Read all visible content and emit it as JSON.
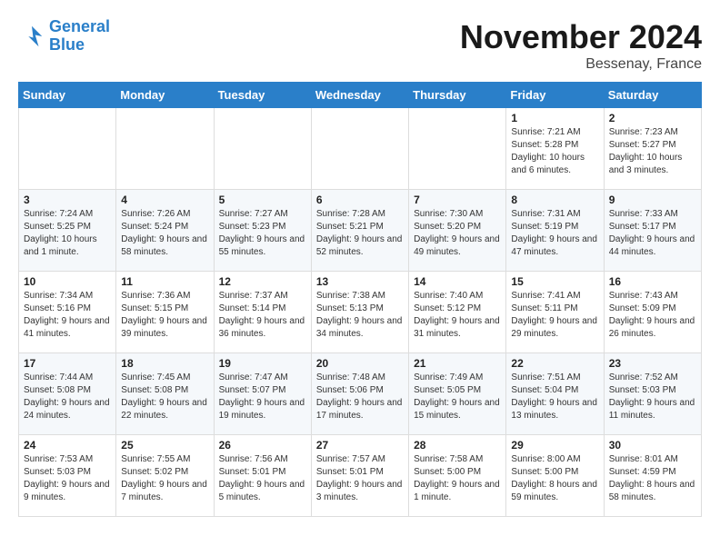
{
  "header": {
    "logo_line1": "General",
    "logo_line2": "Blue",
    "title": "November 2024",
    "subtitle": "Bessenay, France"
  },
  "days_of_week": [
    "Sunday",
    "Monday",
    "Tuesday",
    "Wednesday",
    "Thursday",
    "Friday",
    "Saturday"
  ],
  "weeks": [
    [
      {
        "day": "",
        "info": ""
      },
      {
        "day": "",
        "info": ""
      },
      {
        "day": "",
        "info": ""
      },
      {
        "day": "",
        "info": ""
      },
      {
        "day": "",
        "info": ""
      },
      {
        "day": "1",
        "info": "Sunrise: 7:21 AM\nSunset: 5:28 PM\nDaylight: 10 hours and 6 minutes."
      },
      {
        "day": "2",
        "info": "Sunrise: 7:23 AM\nSunset: 5:27 PM\nDaylight: 10 hours and 3 minutes."
      }
    ],
    [
      {
        "day": "3",
        "info": "Sunrise: 7:24 AM\nSunset: 5:25 PM\nDaylight: 10 hours and 1 minute."
      },
      {
        "day": "4",
        "info": "Sunrise: 7:26 AM\nSunset: 5:24 PM\nDaylight: 9 hours and 58 minutes."
      },
      {
        "day": "5",
        "info": "Sunrise: 7:27 AM\nSunset: 5:23 PM\nDaylight: 9 hours and 55 minutes."
      },
      {
        "day": "6",
        "info": "Sunrise: 7:28 AM\nSunset: 5:21 PM\nDaylight: 9 hours and 52 minutes."
      },
      {
        "day": "7",
        "info": "Sunrise: 7:30 AM\nSunset: 5:20 PM\nDaylight: 9 hours and 49 minutes."
      },
      {
        "day": "8",
        "info": "Sunrise: 7:31 AM\nSunset: 5:19 PM\nDaylight: 9 hours and 47 minutes."
      },
      {
        "day": "9",
        "info": "Sunrise: 7:33 AM\nSunset: 5:17 PM\nDaylight: 9 hours and 44 minutes."
      }
    ],
    [
      {
        "day": "10",
        "info": "Sunrise: 7:34 AM\nSunset: 5:16 PM\nDaylight: 9 hours and 41 minutes."
      },
      {
        "day": "11",
        "info": "Sunrise: 7:36 AM\nSunset: 5:15 PM\nDaylight: 9 hours and 39 minutes."
      },
      {
        "day": "12",
        "info": "Sunrise: 7:37 AM\nSunset: 5:14 PM\nDaylight: 9 hours and 36 minutes."
      },
      {
        "day": "13",
        "info": "Sunrise: 7:38 AM\nSunset: 5:13 PM\nDaylight: 9 hours and 34 minutes."
      },
      {
        "day": "14",
        "info": "Sunrise: 7:40 AM\nSunset: 5:12 PM\nDaylight: 9 hours and 31 minutes."
      },
      {
        "day": "15",
        "info": "Sunrise: 7:41 AM\nSunset: 5:11 PM\nDaylight: 9 hours and 29 minutes."
      },
      {
        "day": "16",
        "info": "Sunrise: 7:43 AM\nSunset: 5:09 PM\nDaylight: 9 hours and 26 minutes."
      }
    ],
    [
      {
        "day": "17",
        "info": "Sunrise: 7:44 AM\nSunset: 5:08 PM\nDaylight: 9 hours and 24 minutes."
      },
      {
        "day": "18",
        "info": "Sunrise: 7:45 AM\nSunset: 5:08 PM\nDaylight: 9 hours and 22 minutes."
      },
      {
        "day": "19",
        "info": "Sunrise: 7:47 AM\nSunset: 5:07 PM\nDaylight: 9 hours and 19 minutes."
      },
      {
        "day": "20",
        "info": "Sunrise: 7:48 AM\nSunset: 5:06 PM\nDaylight: 9 hours and 17 minutes."
      },
      {
        "day": "21",
        "info": "Sunrise: 7:49 AM\nSunset: 5:05 PM\nDaylight: 9 hours and 15 minutes."
      },
      {
        "day": "22",
        "info": "Sunrise: 7:51 AM\nSunset: 5:04 PM\nDaylight: 9 hours and 13 minutes."
      },
      {
        "day": "23",
        "info": "Sunrise: 7:52 AM\nSunset: 5:03 PM\nDaylight: 9 hours and 11 minutes."
      }
    ],
    [
      {
        "day": "24",
        "info": "Sunrise: 7:53 AM\nSunset: 5:03 PM\nDaylight: 9 hours and 9 minutes."
      },
      {
        "day": "25",
        "info": "Sunrise: 7:55 AM\nSunset: 5:02 PM\nDaylight: 9 hours and 7 minutes."
      },
      {
        "day": "26",
        "info": "Sunrise: 7:56 AM\nSunset: 5:01 PM\nDaylight: 9 hours and 5 minutes."
      },
      {
        "day": "27",
        "info": "Sunrise: 7:57 AM\nSunset: 5:01 PM\nDaylight: 9 hours and 3 minutes."
      },
      {
        "day": "28",
        "info": "Sunrise: 7:58 AM\nSunset: 5:00 PM\nDaylight: 9 hours and 1 minute."
      },
      {
        "day": "29",
        "info": "Sunrise: 8:00 AM\nSunset: 5:00 PM\nDaylight: 8 hours and 59 minutes."
      },
      {
        "day": "30",
        "info": "Sunrise: 8:01 AM\nSunset: 4:59 PM\nDaylight: 8 hours and 58 minutes."
      }
    ]
  ]
}
